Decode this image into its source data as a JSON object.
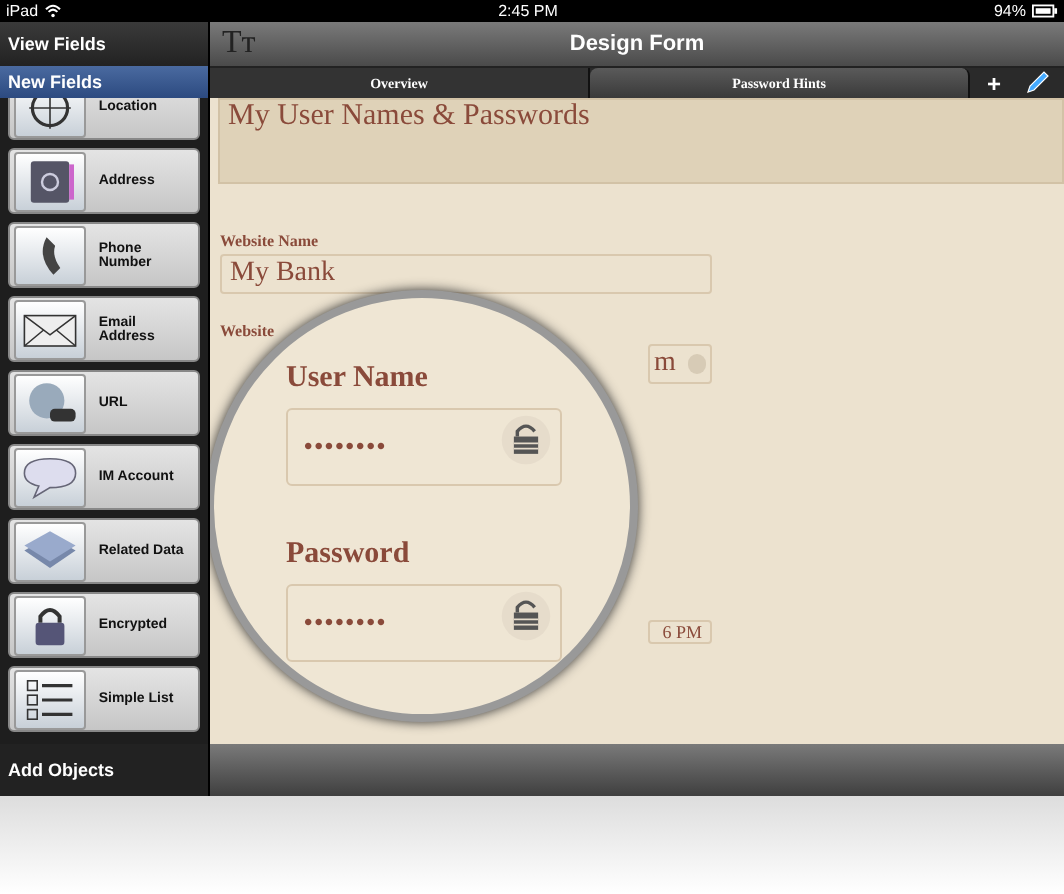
{
  "status_bar": {
    "device": "iPad",
    "time": "2:45 PM",
    "battery": "94%"
  },
  "sidebar": {
    "header": "View Fields",
    "section": "New Fields",
    "items": [
      {
        "label": "Location",
        "kind": "location"
      },
      {
        "label": "Address",
        "kind": "address"
      },
      {
        "label": "Phone Number",
        "kind": "phone"
      },
      {
        "label": "Email Address",
        "kind": "email"
      },
      {
        "label": "URL",
        "kind": "url"
      },
      {
        "label": "IM Account",
        "kind": "im"
      },
      {
        "label": "Related Data",
        "kind": "related"
      },
      {
        "label": "Encrypted",
        "kind": "lock"
      },
      {
        "label": "Simple List",
        "kind": "list"
      }
    ],
    "footer": "Add Objects"
  },
  "toolbar": {
    "font_button": "Tт",
    "title": "Design Form"
  },
  "tabs": [
    {
      "label": "Overview",
      "selected": false
    },
    {
      "label": "Password Hints",
      "selected": true
    }
  ],
  "tab_actions": {
    "add": "+"
  },
  "form": {
    "title": "My User Names & Passwords",
    "fields": [
      {
        "kind": "text",
        "label": "Website Name",
        "value": "My Bank"
      },
      {
        "kind": "dropdown",
        "label": "Website",
        "value": "m"
      },
      {
        "kind": "date",
        "value": "6 PM"
      }
    ]
  },
  "magnifier": {
    "fields": [
      {
        "label": "User Name",
        "value": "••••••••"
      },
      {
        "label": "Password",
        "value": "••••••••"
      }
    ]
  }
}
